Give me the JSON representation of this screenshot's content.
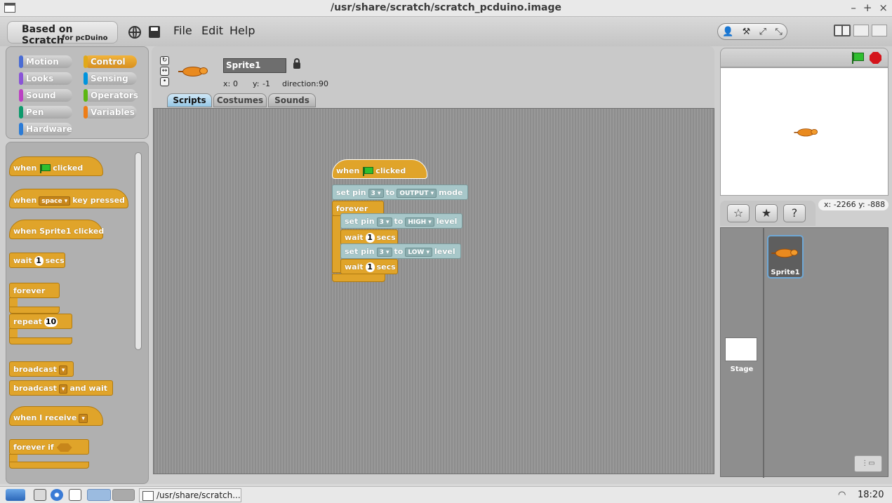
{
  "window": {
    "title": "/usr/share/scratch/scratch_pcduino.image",
    "controls": [
      "–",
      "+",
      "×"
    ]
  },
  "logo": {
    "line1": "Based on Scratch",
    "line2": "for pcDuino"
  },
  "menu": {
    "file": "File",
    "edit": "Edit",
    "help": "Help"
  },
  "toolbar": {
    "icons": [
      "👤",
      "⚒",
      "⤢",
      "⤡"
    ]
  },
  "categories": [
    {
      "label": "Motion",
      "color": "#4a6cd4"
    },
    {
      "label": "Control",
      "color": "#e1a91a"
    },
    {
      "label": "Looks",
      "color": "#8a55d7"
    },
    {
      "label": "Sensing",
      "color": "#0094dd"
    },
    {
      "label": "Sound",
      "color": "#bb42c3"
    },
    {
      "label": "Operators",
      "color": "#5cb712"
    },
    {
      "label": "Pen",
      "color": "#0e9a6c"
    },
    {
      "label": "Variables",
      "color": "#ee7d16"
    },
    {
      "label": "Hardware",
      "color": "#2b7bd6"
    }
  ],
  "palette": {
    "when": "when",
    "clicked": "clicked",
    "space": "space",
    "key_pressed": "key pressed",
    "sprite_clicked": "when Sprite1 clicked",
    "wait": "wait",
    "wait_value": "1",
    "secs": "secs",
    "forever": "forever",
    "repeat": "repeat",
    "repeat_value": "10",
    "broadcast": "broadcast",
    "broadcast_wait": "broadcast",
    "and_wait": "and wait",
    "when_receive": "when I receive",
    "forever_if": "forever if"
  },
  "sprite": {
    "name": "Sprite1",
    "x_label": "x:",
    "x": "0",
    "y_label": "y:",
    "y": "-1",
    "direction_label": "direction:",
    "direction": "90"
  },
  "tabs": [
    "Scripts",
    "Costumes",
    "Sounds"
  ],
  "script": {
    "when": "when",
    "clicked": "clicked",
    "set_pin": "set pin",
    "pin": "3",
    "to": "to",
    "output": "OUTPUT",
    "mode": "mode",
    "forever": "forever",
    "high": "HIGH",
    "level": "level",
    "wait": "wait",
    "wait_value": "1",
    "secs": "secs",
    "low": "LOW"
  },
  "stage": {
    "mouse_x_label": "x:",
    "mouse_x": "-2266",
    "mouse_y_label": "y:",
    "mouse_y": "-888"
  },
  "sprite_buttons": [
    "☆",
    "★",
    "?"
  ],
  "sprite_list": {
    "sprite_name": "Sprite1",
    "stage_label": "Stage"
  },
  "taskbar": {
    "task_label": "/usr/share/scratch...",
    "time": "18:20"
  }
}
